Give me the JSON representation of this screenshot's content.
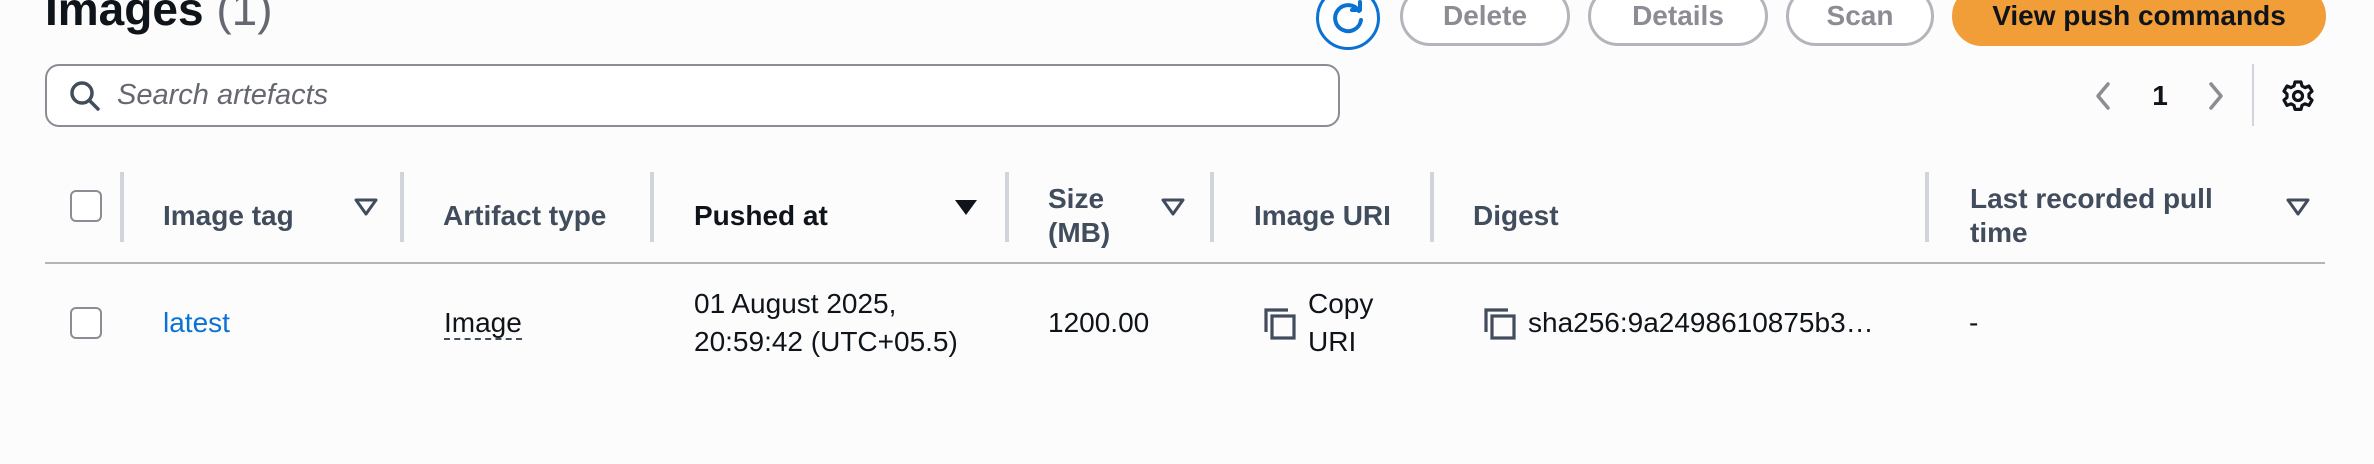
{
  "header": {
    "title": "Images",
    "count": "(1)"
  },
  "toolbar": {
    "refresh_icon": "refresh-icon",
    "delete_label": "Delete",
    "details_label": "Details",
    "scan_label": "Scan",
    "view_push_label": "View push commands"
  },
  "search": {
    "placeholder": "Search artefacts",
    "value": ""
  },
  "pagination": {
    "current_page": "1"
  },
  "table": {
    "columns": [
      {
        "label": "Image tag",
        "sortable": true
      },
      {
        "label": "Artifact type",
        "sortable": false
      },
      {
        "label": "Pushed at",
        "sortable": true,
        "active_sort": true
      },
      {
        "label": "Size (MB)",
        "sortable": true
      },
      {
        "label": "Image URI",
        "sortable": false
      },
      {
        "label": "Digest",
        "sortable": false
      },
      {
        "label": "Last recorded pull time",
        "sortable": true
      }
    ],
    "col_labels": {
      "image_tag": "Image tag",
      "artifact_type": "Artifact type",
      "pushed_at": "Pushed at",
      "size_line1": "Size",
      "size_line2": "(MB)",
      "image_uri": "Image URI",
      "digest": "Digest",
      "last_pull_line1": "Last recorded pull",
      "last_pull_line2": "time"
    },
    "rows": [
      {
        "image_tag": "latest",
        "artifact_type": "Image",
        "pushed_at_line1": "01 August 2025,",
        "pushed_at_line2": "20:59:42 (UTC+05.5)",
        "size": "1200.00",
        "image_uri_line1": "Copy",
        "image_uri_line2": "URI",
        "digest": "sha256:9a2498610875b3…",
        "last_pull": "-"
      }
    ]
  },
  "colors": {
    "primary_button": "#f19e38",
    "link": "#0972d3",
    "border": "#8c8c94"
  }
}
